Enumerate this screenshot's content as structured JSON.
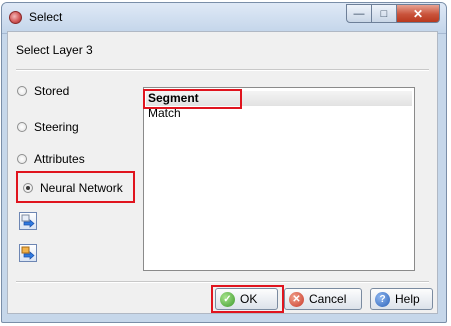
{
  "window": {
    "title": "Select"
  },
  "caption_buttons": {
    "minimize": "—",
    "maximize": "□",
    "close": "✕"
  },
  "header": {
    "label": "Select Layer 3"
  },
  "radios": [
    {
      "label": "Stored",
      "selected": false
    },
    {
      "label": "Steering",
      "selected": false
    },
    {
      "label": "Attributes",
      "selected": false
    },
    {
      "label": "Neural Network",
      "selected": true
    }
  ],
  "side_buttons": [
    {
      "icon": "load-arrow-icon"
    },
    {
      "icon": "import-arrow-icon"
    }
  ],
  "list": {
    "items": [
      "Segment",
      "Match"
    ],
    "selected_index": 0
  },
  "buttons": {
    "ok_label": "OK",
    "cancel_label": "Cancel",
    "help_label": "Help"
  },
  "colors": {
    "highlight": "#e0141e",
    "accent": "#2b62b8"
  }
}
